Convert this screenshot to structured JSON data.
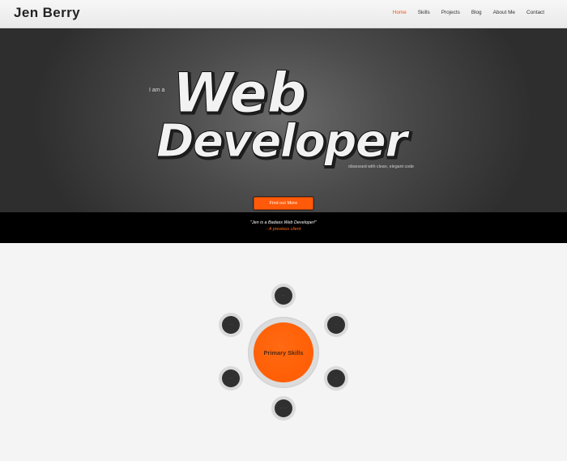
{
  "header": {
    "logo": "Jen Berry",
    "nav": [
      "Home",
      "Skills",
      "Projects",
      "Blog",
      "About Me",
      "Contact"
    ],
    "active_index": 0
  },
  "hero": {
    "pre": "I am a",
    "title_line1": "Web",
    "title_line2": "Developer",
    "tagline": "obsessed with clean, elegant code",
    "cta": "Find out More"
  },
  "quote": {
    "text": "\"Jen is a Badass Web Developer!\"",
    "attribution": "- A previous client"
  },
  "skills": {
    "core_label": "Primary Skills",
    "nodes": [
      "····",
      "···",
      "····",
      "··· ····",
      "···",
      "·· ···"
    ]
  },
  "colors": {
    "accent": "#ff5a00",
    "nav_active": "#e8571d",
    "quote_attribution": "#ff6a1a"
  }
}
